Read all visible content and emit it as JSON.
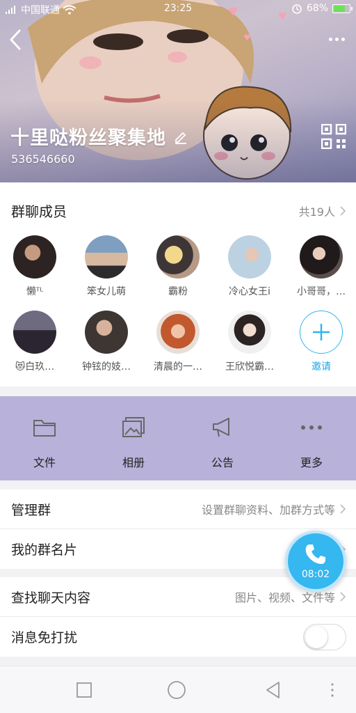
{
  "status_bar": {
    "carrier": "中国联通",
    "time": "23:25",
    "battery": "68%",
    "battery_level": 0.68
  },
  "header": {
    "group_name": "十里哒粉丝聚集地",
    "group_id": "536546660"
  },
  "members": {
    "title": "群聊成员",
    "count_label": "共19人",
    "list": [
      {
        "name": "懒ᵀᴸ"
      },
      {
        "name": "笨女儿萌"
      },
      {
        "name": "霸粉"
      },
      {
        "name": "冷心女王i"
      },
      {
        "name": "小哥哥，…"
      },
      {
        "name": "😻白玖…"
      },
      {
        "name": "钟铉的妓…"
      },
      {
        "name": "清晨的一…"
      },
      {
        "name": "王欣悦霸…"
      }
    ],
    "invite_label": "邀请"
  },
  "actions": [
    {
      "label": "文件",
      "icon": "folder-icon"
    },
    {
      "label": "相册",
      "icon": "album-icon"
    },
    {
      "label": "公告",
      "icon": "megaphone-icon"
    },
    {
      "label": "更多",
      "icon": "more-dots-icon"
    }
  ],
  "settings": {
    "manage_group": {
      "title": "管理群",
      "value": "设置群聊资料、加群方式等"
    },
    "my_card": {
      "title": "我的群名片",
      "value": ""
    },
    "search_chat": {
      "title": "查找聊天内容",
      "value": "图片、视频、文件等"
    },
    "mute": {
      "title": "消息免打扰",
      "enabled": false
    }
  },
  "call_float": {
    "time": "08:02"
  },
  "colors": {
    "accent": "#35b7f0",
    "action_bar": "#b8b1d9"
  }
}
